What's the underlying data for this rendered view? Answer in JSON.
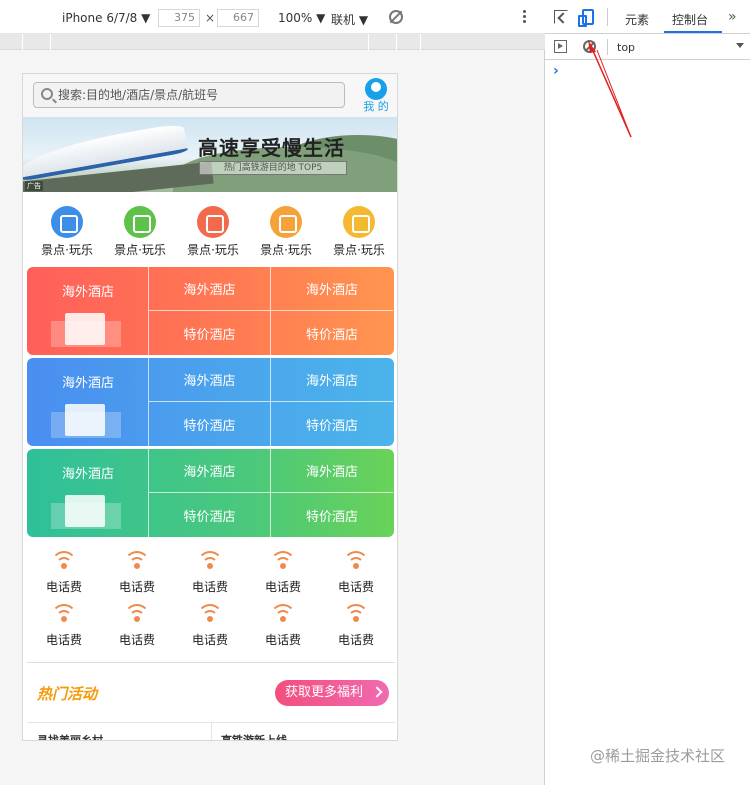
{
  "device_toolbar": {
    "device": "iPhone 6/7/8 ▼",
    "width": "375",
    "times": "×",
    "height": "667",
    "zoom": "100% ▼",
    "network": "联机 ▼"
  },
  "phone": {
    "search": {
      "placeholder": "搜索:目的地/酒店/景点/航班号"
    },
    "me_label": "我 的",
    "banner": {
      "title": "高速享受慢生活",
      "subtitle": "热门高铁游目的地 TOP5",
      "ad": "广告"
    },
    "categories": [
      {
        "label": "景点·玩乐",
        "color": "#3d8ee8"
      },
      {
        "label": "景点·玩乐",
        "color": "#5ec24a"
      },
      {
        "label": "景点·玩乐",
        "color": "#f2694c"
      },
      {
        "label": "景点·玩乐",
        "color": "#f6a23a"
      },
      {
        "label": "景点·玩乐",
        "color": "#f5b931"
      }
    ],
    "hotel_groups": [
      {
        "theme": "red",
        "main": "海外酒店",
        "cells": [
          "海外酒店",
          "海外酒店",
          "特价酒店",
          "特价酒店"
        ]
      },
      {
        "theme": "blue",
        "main": "海外酒店",
        "cells": [
          "海外酒店",
          "海外酒店",
          "特价酒店",
          "特价酒店"
        ]
      },
      {
        "theme": "green",
        "main": "海外酒店",
        "cells": [
          "海外酒店",
          "海外酒店",
          "特价酒店",
          "特价酒店"
        ]
      }
    ],
    "services": [
      "电话费",
      "电话费",
      "电话费",
      "电话费",
      "电话费",
      "电话费",
      "电话费",
      "电话费",
      "电话费",
      "电话费"
    ],
    "hot": {
      "title": "热门活动",
      "more_button": "获取更多福利"
    },
    "list_titles": [
      "寻找美丽乡村",
      "高铁游新上线"
    ]
  },
  "devtools": {
    "tabs": [
      "元素",
      "控制台"
    ],
    "more": "»",
    "context": "top",
    "prompt": "›"
  },
  "watermark": "@稀土掘金技术社区",
  "colors": {
    "accent": "#1a73e8",
    "hot_title": "#f59b0b",
    "annotation_arrow": "#e02020"
  }
}
